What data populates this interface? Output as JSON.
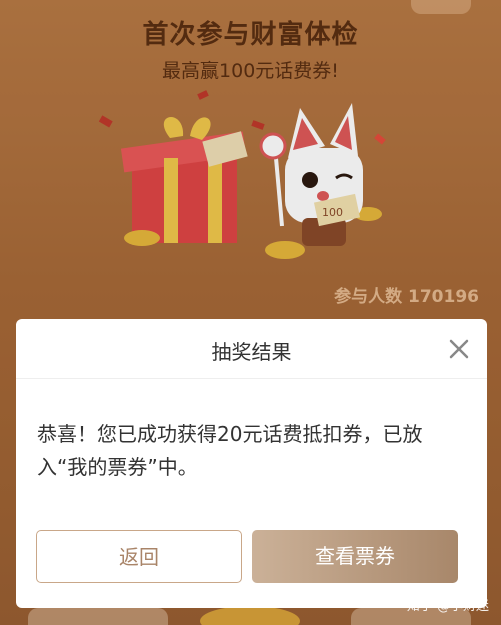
{
  "promo": {
    "title": "首次参与财富体检",
    "subtitle": "最高赢100元话费券!",
    "participants": "参与人数 170196",
    "voucher_tag": "100"
  },
  "dialog": {
    "title": "抽奖结果",
    "message": "恭喜！您已成功获得20元话费抵扣券，已放入“我的票券”中。",
    "back_label": "返回",
    "view_label": "查看票券",
    "close_icon": "close-icon"
  },
  "watermark": "知乎 @小财迷"
}
